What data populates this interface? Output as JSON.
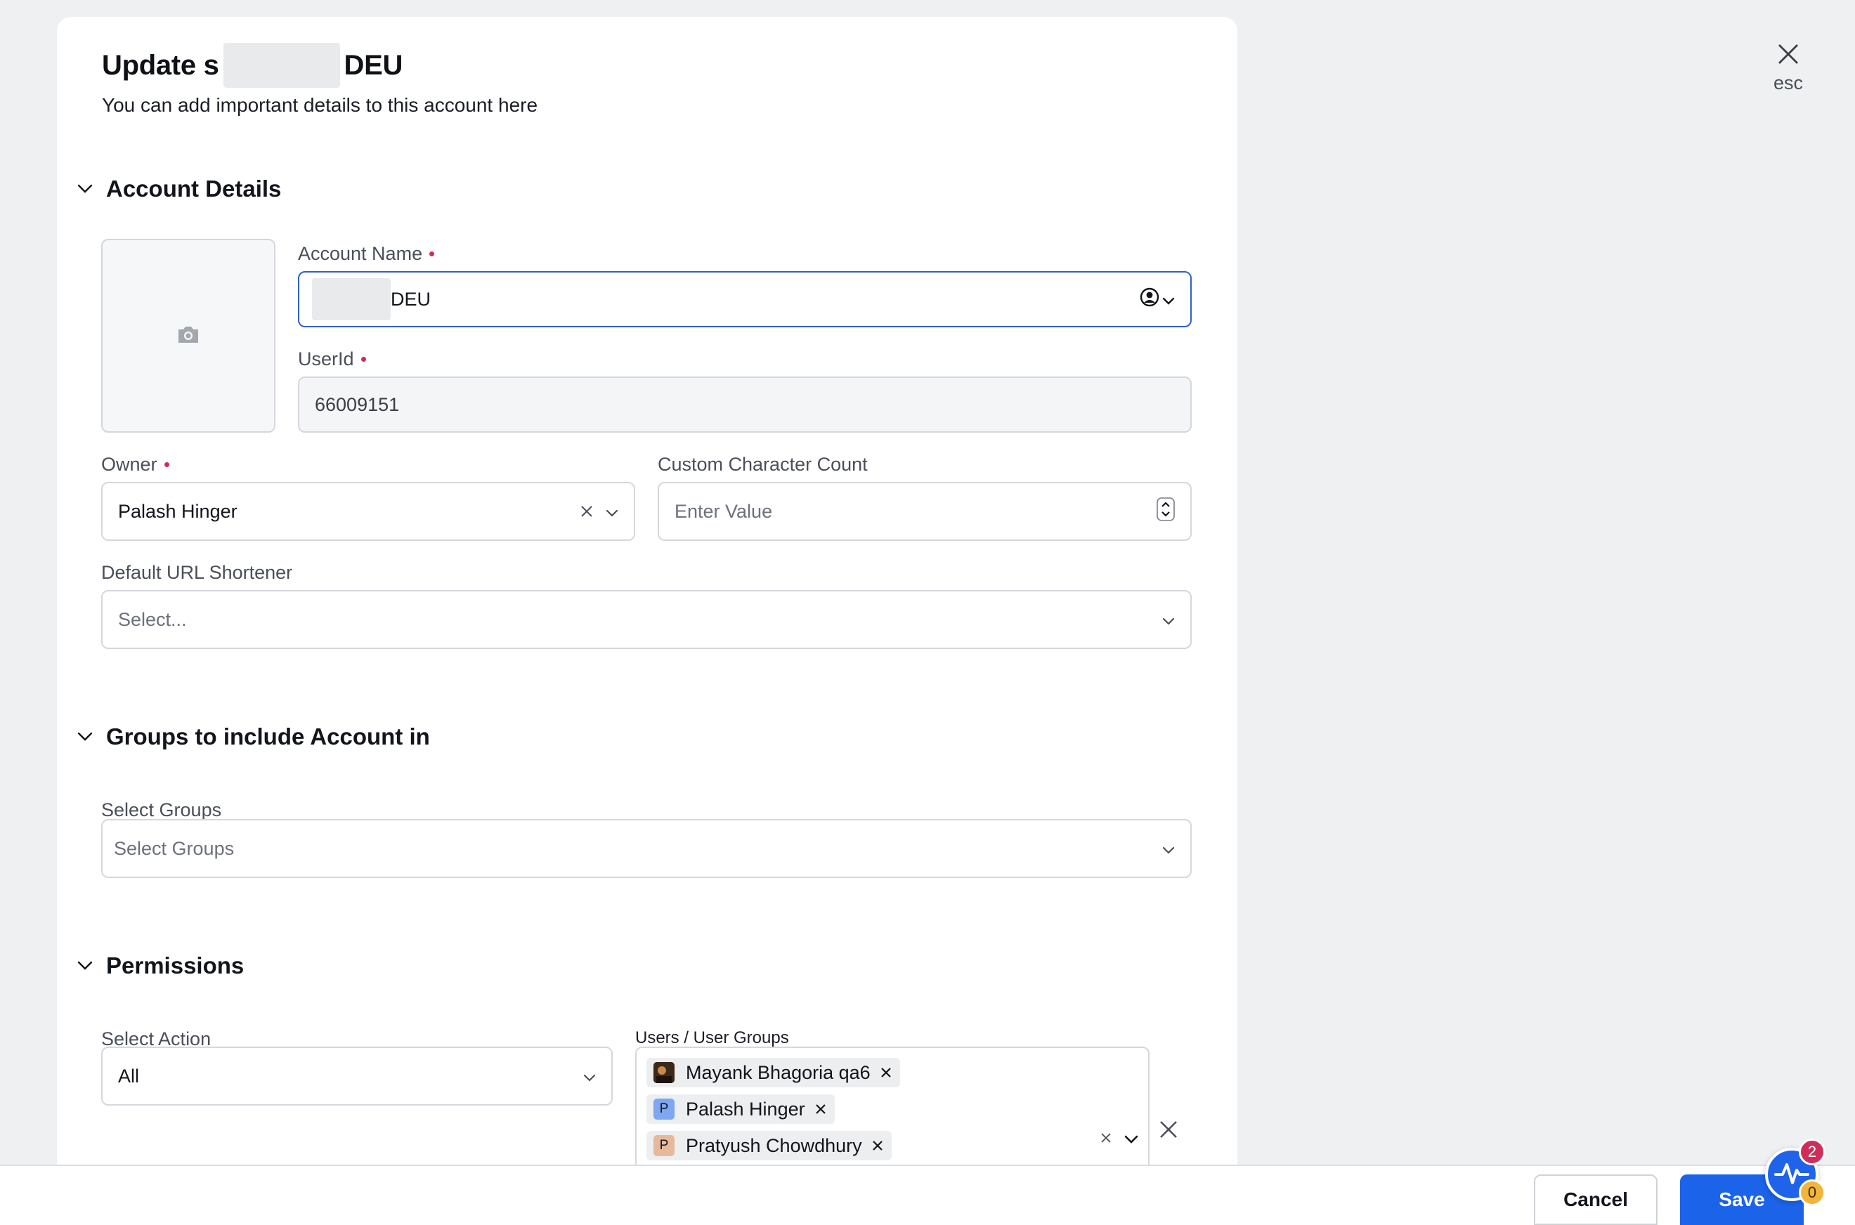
{
  "modal": {
    "title_prefix": "Update s",
    "title_suffix": "DEU",
    "subtitle": "You can add important details to this account here",
    "close_hint": "esc"
  },
  "sections": {
    "account_details": "Account Details",
    "groups": "Groups to include Account in",
    "permissions": "Permissions"
  },
  "account_details": {
    "account_name": {
      "label": "Account Name",
      "value_suffix": "DEU"
    },
    "user_id": {
      "label": "UserId",
      "value": "66009151"
    },
    "owner": {
      "label": "Owner",
      "value": "Palash Hinger"
    },
    "custom_character_count": {
      "label": "Custom Character Count",
      "placeholder": "Enter Value"
    },
    "default_url_shortener": {
      "label": "Default URL Shortener",
      "placeholder": "Select..."
    }
  },
  "groups": {
    "select_groups": {
      "label": "Select Groups",
      "placeholder": "Select Groups"
    }
  },
  "permissions": {
    "select_action": {
      "label": "Select Action",
      "value": "All"
    },
    "users_label": "Users / User Groups",
    "users": [
      {
        "name": "Mayank Bhagoria qa6",
        "avatar": "",
        "avatar_color": "#6b4a2b"
      },
      {
        "name": "Palash Hinger",
        "avatar": "P",
        "avatar_color": "#7fa6f0"
      },
      {
        "name": "Pratyush Chowdhury",
        "avatar": "P",
        "avatar_color": "#e7b89a"
      }
    ]
  },
  "footer": {
    "cancel": "Cancel",
    "save": "Save"
  },
  "notifications": {
    "red_count": "2",
    "yellow_count": "0"
  },
  "colors": {
    "accent": "#1b63e8",
    "required": "#d12a5c",
    "focus_border": "#2f5fd0"
  }
}
